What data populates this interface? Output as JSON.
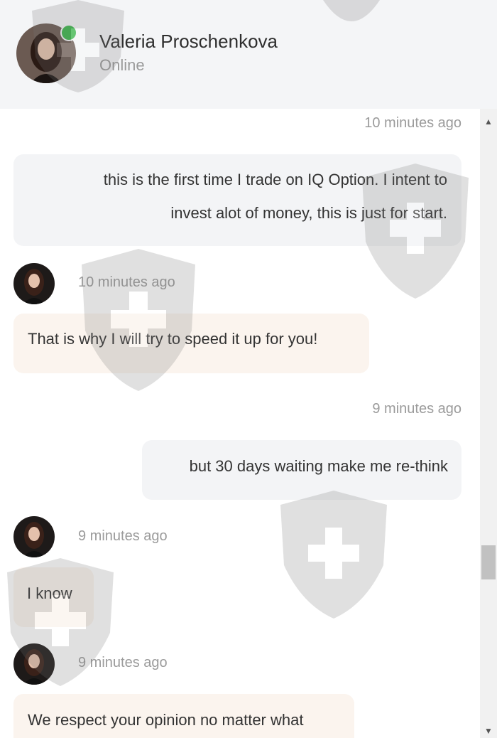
{
  "contact": {
    "name": "Valeria Proschenkova",
    "status": "Online"
  },
  "colors": {
    "presence": "#3bb54a",
    "outgoing_bubble": "#f3f4f6",
    "incoming_bubble": "#fbf4ee"
  },
  "messages": [
    {
      "direction": "outgoing",
      "timestamp": "10 minutes ago",
      "line1": "this is the first time I trade on IQ Option. I intent to",
      "line2": "invest alot of money, this is just for start."
    },
    {
      "direction": "incoming",
      "timestamp": "10 minutes ago",
      "text": "That is why I will try to speed it up for you!"
    },
    {
      "direction": "outgoing",
      "timestamp": "9 minutes ago",
      "text": "but 30 days waiting make me re-think"
    },
    {
      "direction": "incoming",
      "timestamp": "9 minutes ago",
      "text": "I know"
    },
    {
      "direction": "incoming",
      "timestamp": "9 minutes ago",
      "text": "We respect your opinion no matter what"
    }
  ]
}
